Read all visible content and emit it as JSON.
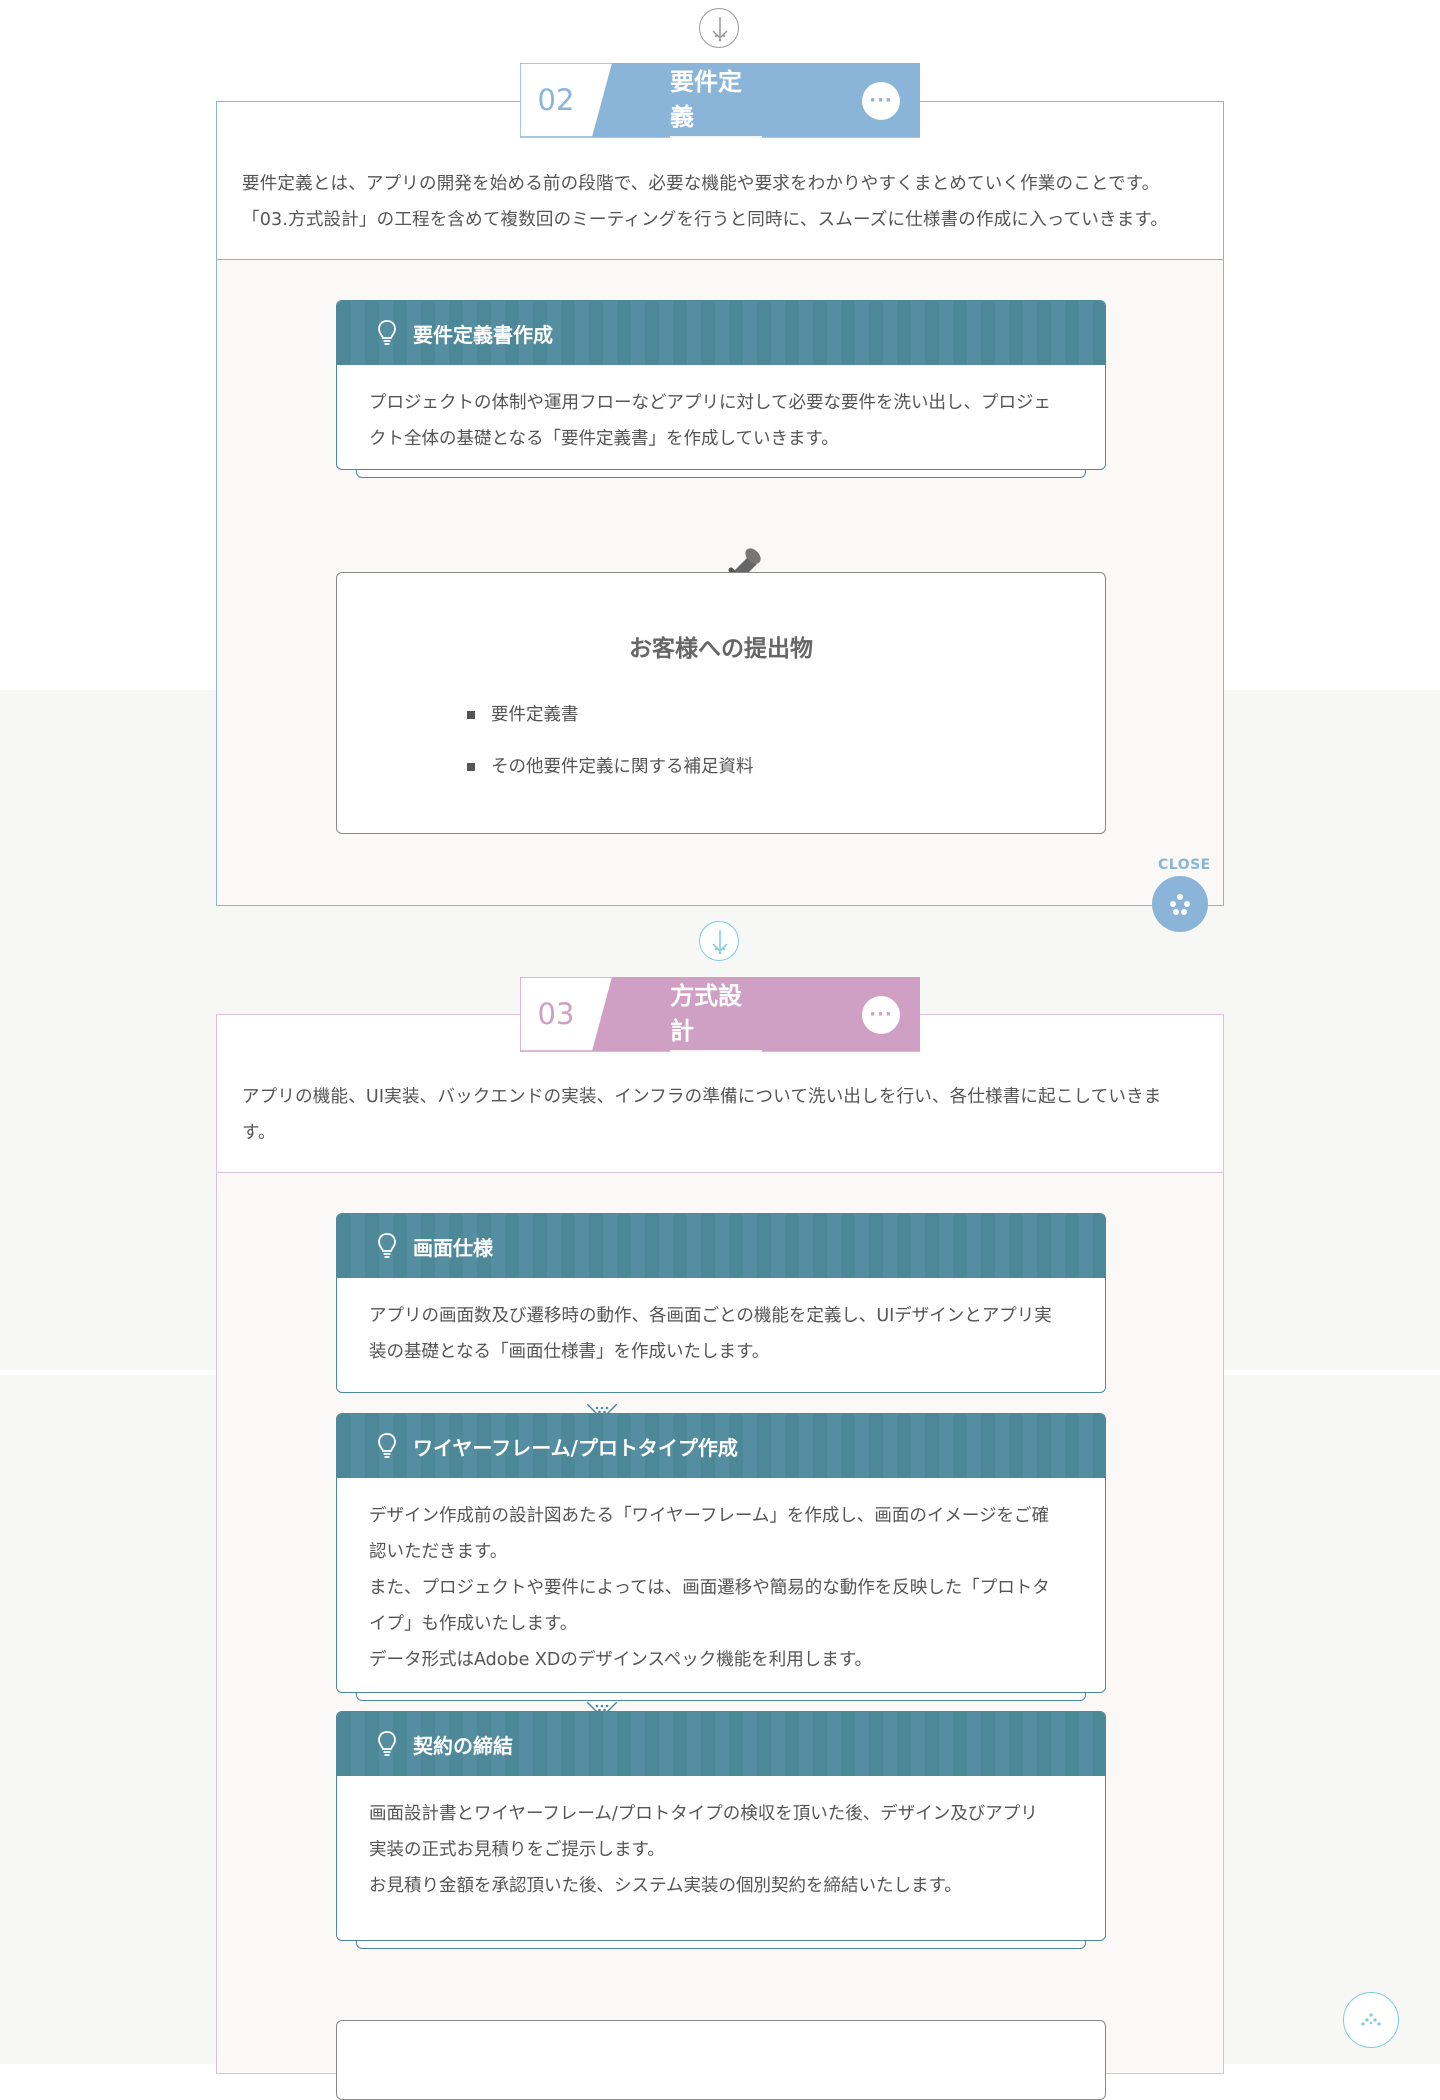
{
  "colors": {
    "section02_accent": "#8ab5d9",
    "section03_accent": "#cfa0c4",
    "card_header": "#4d8899",
    "arrow_blue": "#7fcbd9"
  },
  "sections": [
    {
      "number": "02",
      "title": "要件定義",
      "more_label": "···",
      "intro": [
        "要件定義とは、アプリの開発を始める前の段階で、必要な機能や要求をわかりやすくまとめていく作業のことです。",
        "「03.方式設計」の工程を含めて複数回のミーティングを行うと同時に、スムーズに仕様書の作成に入っていきます。"
      ],
      "cards": [
        {
          "icon": "lightbulb-icon",
          "title": "要件定義書作成",
          "lines": [
            "プロジェクトの体制や運用フローなどアプリに対して必要な要件を洗い出し、プロジェ",
            "クト全体の基礎となる「要件定義書」を作成していきます。"
          ]
        }
      ],
      "deliverables": {
        "icon": "pushpin-icon",
        "title": "お客様への提出物",
        "items": [
          "要件定義書",
          "その他要件定義に関する補足資料"
        ]
      },
      "close_label": "CLOSE"
    },
    {
      "number": "03",
      "title": "方式設計",
      "more_label": "···",
      "intro": [
        "アプリの機能、UI実装、バックエンドの実装、インフラの準備について洗い出しを行い、各仕様書に起こしていきま",
        "す。"
      ],
      "cards": [
        {
          "icon": "lightbulb-icon",
          "title": "画面仕様",
          "lines": [
            "アプリの画面数及び遷移時の動作、各画面ごとの機能を定義し、UIデザインとアプリ実",
            "装の基礎となる「画面仕様書」を作成いたします。"
          ]
        },
        {
          "icon": "lightbulb-icon",
          "title": "ワイヤーフレーム/プロトタイプ作成",
          "lines": [
            "デザイン作成前の設計図あたる「ワイヤーフレーム」を作成し、画面のイメージをご確",
            "認いただきます。",
            "また、プロジェクトや要件によっては、画面遷移や簡易的な動作を反映した「プロトタ",
            "イプ」も作成いたします。",
            "データ形式はAdobe XDのデザインスペック機能を利用します。"
          ]
        },
        {
          "icon": "lightbulb-icon",
          "title": "契約の締結",
          "lines": [
            "画面設計書とワイヤーフレーム/プロトタイプの検収を頂いた後、デザイン及びアプリ",
            "実装の正式お見積りをご提示します。",
            "お見積り金額を承認頂いた後、システム実装の個別契約を締結いたします。"
          ]
        }
      ]
    }
  ]
}
